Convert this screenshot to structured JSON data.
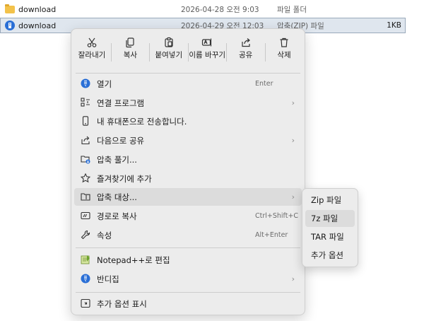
{
  "files": [
    {
      "name": "download",
      "date": "2026-04-28 오전 9:03",
      "type": "파일 폴더",
      "size": "",
      "icon": "folder-icon"
    },
    {
      "name": "download",
      "date": "2026-04-29 오전 12:03",
      "type": "압축(ZIP) 파일",
      "size": "1KB",
      "icon": "zip-icon"
    }
  ],
  "toolbar": {
    "cut": "잘라내기",
    "copy": "복사",
    "paste": "붙여넣기",
    "rename": "이름 바꾸기",
    "share": "공유",
    "delete": "삭제"
  },
  "menu": [
    {
      "label": "열기",
      "shortcut": "Enter",
      "icon": "open-icon"
    },
    {
      "label": "연결 프로그램",
      "arrow": "›",
      "icon": "open-with-icon"
    },
    {
      "label": "내 휴대폰으로 전송합니다.",
      "icon": "phone-icon"
    },
    {
      "label": "다음으로 공유",
      "arrow": "›",
      "icon": "share-icon"
    },
    {
      "label": "압축 풀기...",
      "icon": "extract-icon"
    },
    {
      "label": "즐겨찾기에 추가",
      "icon": "star-icon"
    },
    {
      "label": "압축 대상...",
      "arrow": "›",
      "icon": "compress-icon"
    },
    {
      "label": "경로로 복사",
      "shortcut": "Ctrl+Shift+C",
      "icon": "path-icon"
    },
    {
      "label": "속성",
      "shortcut": "Alt+Enter",
      "icon": "wrench-icon"
    },
    {
      "label": "Notepad++로 편집",
      "icon": "notepad-icon"
    },
    {
      "label": "반디집",
      "arrow": "›",
      "icon": "bandizip-icon"
    },
    {
      "label": "추가 옵션 표시",
      "icon": "more-options-icon"
    }
  ],
  "submenu": [
    "Zip 파일",
    "7z 파일",
    "TAR 파일",
    "추가 옵션"
  ],
  "colors": {
    "accent": "#2a6fd6",
    "highlight": "#dcdcdc",
    "menu_bg": "#ececec"
  }
}
